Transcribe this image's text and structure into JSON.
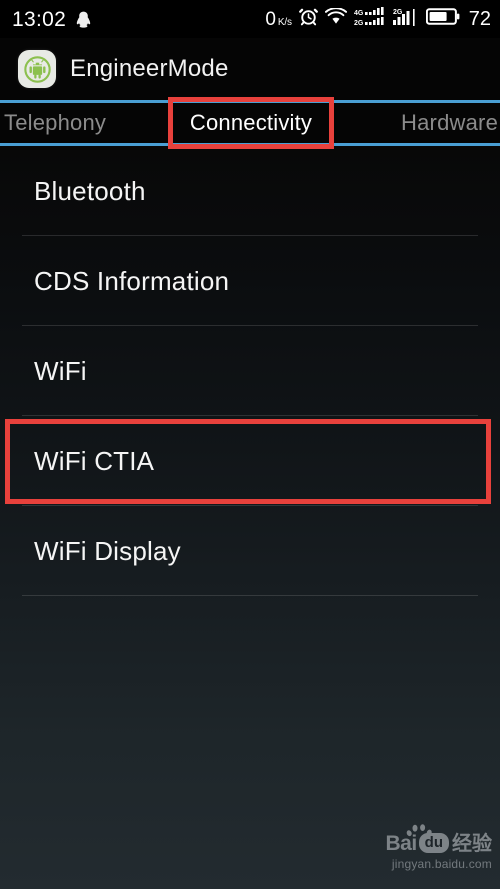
{
  "status_bar": {
    "clock": "13:02",
    "qq_icon": "qq-penguin-icon",
    "network_speed": "0",
    "network_speed_unit": "K/s",
    "alarm_icon": "alarm-clock-icon",
    "wifi_icon": "wifi-icon",
    "sim1_icon": "4g-2g-signal-icon",
    "sim2_icon": "2g-signal-icon",
    "battery_icon": "battery-icon",
    "battery_level": "72"
  },
  "app_bar": {
    "icon": "android-robot-icon",
    "title": "EngineerMode"
  },
  "tabs": [
    {
      "label": "Telephony",
      "active": false
    },
    {
      "label": "Connectivity",
      "active": true
    },
    {
      "label": "Hardware",
      "active": false
    }
  ],
  "list": {
    "items": [
      {
        "label": "Bluetooth"
      },
      {
        "label": "CDS Information"
      },
      {
        "label": "WiFi"
      },
      {
        "label": "WiFi CTIA"
      },
      {
        "label": "WiFi Display"
      }
    ]
  },
  "annotations": {
    "tab_highlight": "Connectivity",
    "row_highlight": "WiFi CTIA",
    "color": "#e8413c"
  },
  "watermark": {
    "bai": "Bai",
    "du": "du",
    "jingyan": "经验",
    "url": "jingyan.baidu.com",
    "paw_icon": "paw-print-icon"
  },
  "colors": {
    "accent_blue": "#4a9fd4",
    "annotation_red": "#e8413c",
    "text_primary": "#f5f5f5",
    "text_muted": "#8b8b8b",
    "android_green": "#8cc04f"
  }
}
